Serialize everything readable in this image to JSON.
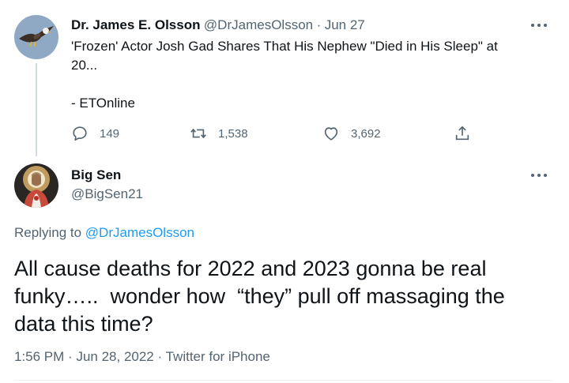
{
  "parent_tweet": {
    "display_name": "Dr. James E. Olsson",
    "handle": "@DrJamesOlsson",
    "separator": "·",
    "date": "Jun 27",
    "text_line1": "'Frozen' Actor Josh Gad Shares That His Nephew \"Died in His Sleep\" at",
    "text_line2": "20...",
    "text_line3": "- ETOnline",
    "replies": "149",
    "retweets": "1,538",
    "likes": "3,692",
    "avatar_icon": "eagle-avatar"
  },
  "main_tweet": {
    "display_name": "Big Sen",
    "handle": "@BigSen21",
    "replying_prefix": "Replying to",
    "replying_handle": "@DrJamesOlsson",
    "text_line1": "All cause deaths for 2022 and 2023 gonna be real",
    "text_line2": "funky…..  wonder how  “they” pull off massaging the",
    "text_line3": "data this time?",
    "time": "1:56 PM",
    "sep1": "·",
    "date": "Jun 28, 2022",
    "sep2": "·",
    "source": "Twitter for iPhone",
    "avatar_icon": "portrait-avatar"
  },
  "icons": {
    "reply": "reply-icon",
    "retweet": "retweet-icon",
    "like": "heart-icon",
    "share": "share-icon",
    "more": "more-icon"
  },
  "colors": {
    "link": "#1d9bf0",
    "muted": "#536471",
    "text": "#0f1419"
  }
}
